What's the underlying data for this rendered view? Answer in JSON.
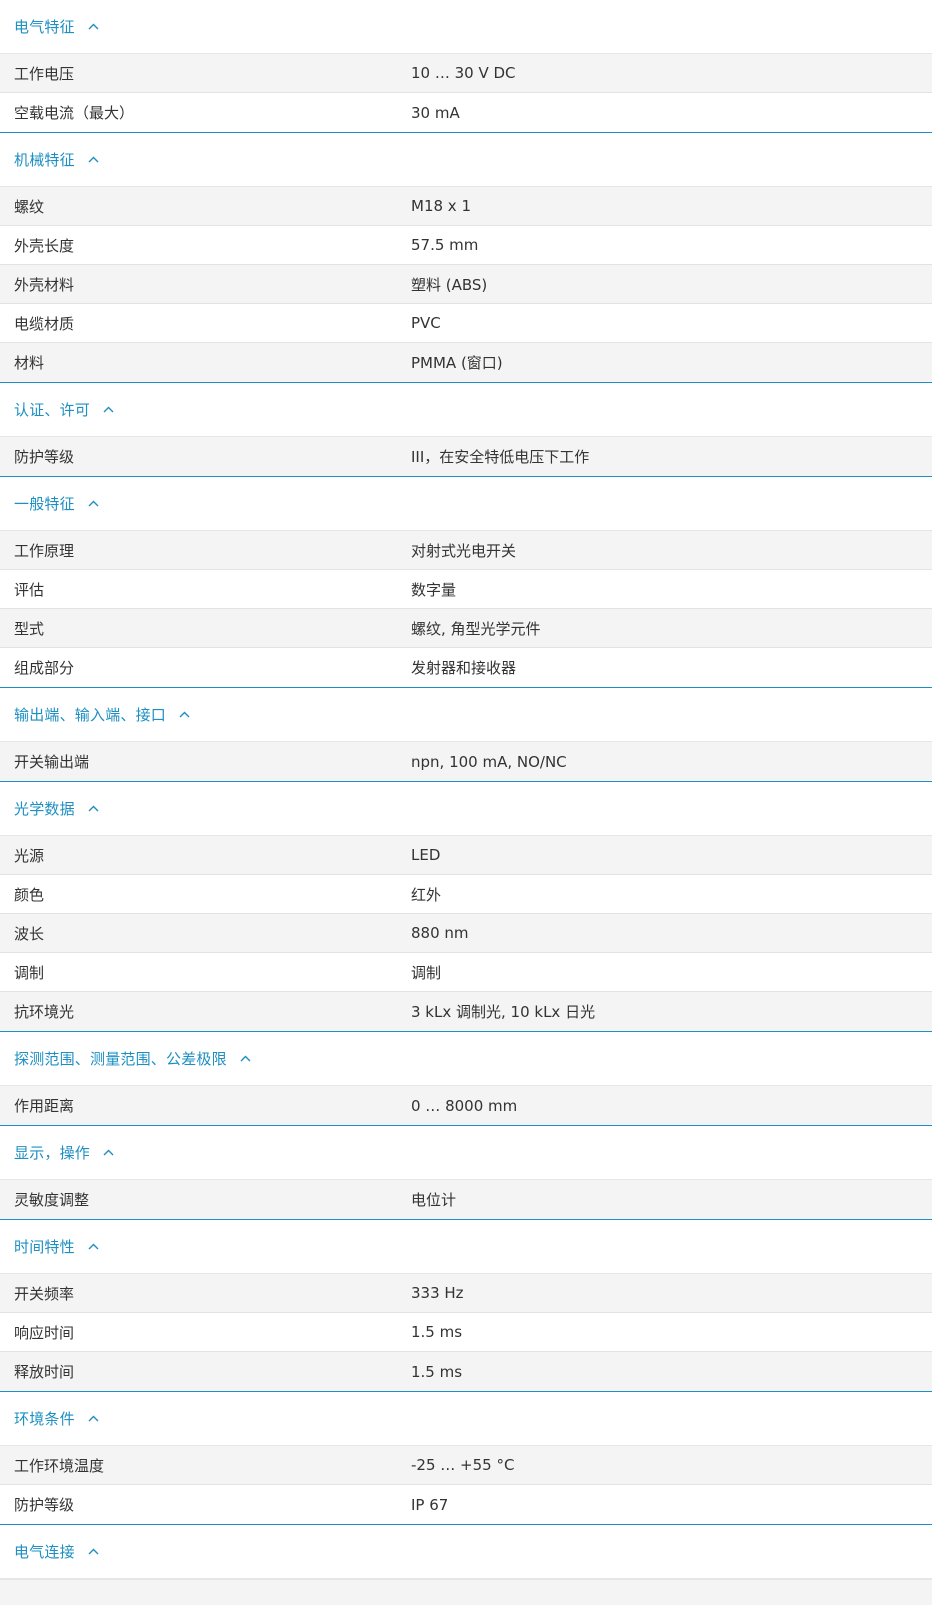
{
  "colors": {
    "accent": "#1d8fc2",
    "row_alt": "#f4f4f4",
    "text": "#333333"
  },
  "chevron_icon": "chevron-up-icon",
  "sections": [
    {
      "title": "电气特征",
      "rows": [
        {
          "label": "工作电压",
          "value": "10 … 30 V DC"
        },
        {
          "label": "空载电流（最大）",
          "value": "30 mA"
        }
      ]
    },
    {
      "title": "机械特征",
      "rows": [
        {
          "label": "螺纹",
          "value": "M18 x 1"
        },
        {
          "label": "外壳长度",
          "value": "57.5 mm"
        },
        {
          "label": "外壳材料",
          "value": "塑料 (ABS)"
        },
        {
          "label": "电缆材质",
          "value": "PVC"
        },
        {
          "label": "材料",
          "value": "PMMA (窗口)"
        }
      ]
    },
    {
      "title": "认证、许可",
      "rows": [
        {
          "label": "防护等级",
          "value": "III，在安全特低电压下工作"
        }
      ]
    },
    {
      "title": "一般特征",
      "rows": [
        {
          "label": "工作原理",
          "value": "对射式光电开关"
        },
        {
          "label": "评估",
          "value": "数字量"
        },
        {
          "label": "型式",
          "value": "螺纹, 角型光学元件"
        },
        {
          "label": "组成部分",
          "value": "发射器和接收器"
        }
      ]
    },
    {
      "title": "输出端、输入端、接口",
      "rows": [
        {
          "label": "开关输出端",
          "value": "npn, 100 mA, NO/NC"
        }
      ]
    },
    {
      "title": "光学数据",
      "rows": [
        {
          "label": "光源",
          "value": "LED"
        },
        {
          "label": "颜色",
          "value": "红外"
        },
        {
          "label": "波长",
          "value": "880 nm"
        },
        {
          "label": "调制",
          "value": "调制"
        },
        {
          "label": "抗环境光",
          "value": "3 kLx 调制光, 10 kLx 日光"
        }
      ]
    },
    {
      "title": "探测范围、测量范围、公差极限",
      "rows": [
        {
          "label": "作用距离",
          "value": "0 … 8000 mm"
        }
      ]
    },
    {
      "title": "显示，操作",
      "rows": [
        {
          "label": "灵敏度调整",
          "value": "电位计"
        }
      ]
    },
    {
      "title": "时间特性",
      "rows": [
        {
          "label": "开关频率",
          "value": "333 Hz"
        },
        {
          "label": "响应时间",
          "value": "1.5 ms"
        },
        {
          "label": "释放时间",
          "value": "1.5 ms"
        }
      ]
    },
    {
      "title": "环境条件",
      "rows": [
        {
          "label": "工作环境温度",
          "value": "-25 … +55 °C"
        },
        {
          "label": "防护等级",
          "value": "IP 67"
        }
      ]
    },
    {
      "title": "电气连接",
      "rows": []
    }
  ]
}
